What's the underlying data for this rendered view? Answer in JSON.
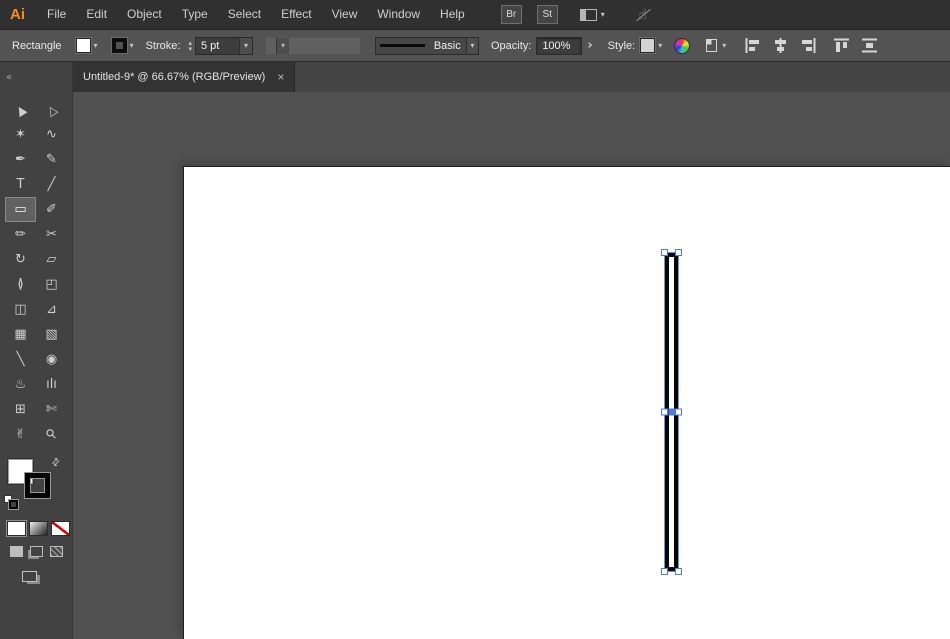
{
  "colors": {
    "accent_selection_blue": "#6f94e4",
    "handle_border_blue": "#4f7ad6",
    "menubar_bg": "#303030",
    "controlbar_bg": "#535353",
    "toolbar_bg": "#424242",
    "pasteboard_bg": "#515151",
    "artboard_bg": "#ffffff",
    "logo_orange": "#ff8a1e",
    "object_stroke": "#060606",
    "object_fill": "#ffffff"
  },
  "menubar": {
    "logo": "Ai",
    "menus": [
      {
        "label": "File",
        "name": "menu-file"
      },
      {
        "label": "Edit",
        "name": "menu-edit"
      },
      {
        "label": "Object",
        "name": "menu-object"
      },
      {
        "label": "Type",
        "name": "menu-type"
      },
      {
        "label": "Select",
        "name": "menu-select"
      },
      {
        "label": "Effect",
        "name": "menu-effect"
      },
      {
        "label": "View",
        "name": "menu-view"
      },
      {
        "label": "Window",
        "name": "menu-window"
      },
      {
        "label": "Help",
        "name": "menu-help"
      }
    ],
    "br": "Br",
    "st": "St"
  },
  "controlbar": {
    "tool_label": "Rectangle",
    "stroke_label": "Stroke:",
    "stroke_value": "5 pt",
    "brush_label": "Basic",
    "opacity_label": "Opacity:",
    "opacity_value": "100%",
    "style_label": "Style:"
  },
  "tabbar": {
    "title": "Untitled-9* @ 66.67% (RGB/Preview)",
    "close": "×"
  },
  "icons": {
    "caret": "▾",
    "stepper_up": "▴",
    "stepper_down": "▾",
    "collapse": "«",
    "swap": "⇄",
    "expand": "›",
    "touch": "☝"
  },
  "toolbar": {
    "tools": [
      {
        "name": "selection-tool",
        "glyph": "▲",
        "glyphCls": "rot-arrow"
      },
      {
        "name": "direct-selection-tool",
        "glyph": "△",
        "glyphCls": "rot-arrow"
      },
      {
        "name": "magic-wand-tool",
        "glyph": "✶"
      },
      {
        "name": "lasso-tool",
        "glyph": "∿"
      },
      {
        "name": "pen-tool",
        "glyph": "✒"
      },
      {
        "name": "curvature-tool",
        "glyph": "✎"
      },
      {
        "name": "type-tool",
        "glyph": "T"
      },
      {
        "name": "line-segment-tool",
        "glyph": "╱"
      },
      {
        "name": "rectangle-tool",
        "glyph": "▭",
        "cellCls": "selected"
      },
      {
        "name": "paintbrush-tool",
        "glyph": "✐"
      },
      {
        "name": "shaper-tool",
        "glyph": "✏"
      },
      {
        "name": "scissors-tool",
        "glyph": "✂"
      },
      {
        "name": "rotate-tool",
        "glyph": "↻"
      },
      {
        "name": "scale-tool",
        "glyph": "▱"
      },
      {
        "name": "width-tool",
        "glyph": "≬"
      },
      {
        "name": "free-transform-tool",
        "glyph": "◰"
      },
      {
        "name": "shape-builder-tool",
        "glyph": "◫"
      },
      {
        "name": "perspective-grid-tool",
        "glyph": "⊿"
      },
      {
        "name": "mesh-tool",
        "glyph": "▦"
      },
      {
        "name": "gradient-tool",
        "glyph": "▧"
      },
      {
        "name": "eyedropper-tool",
        "glyph": "╲"
      },
      {
        "name": "blend-tool",
        "glyph": "◉"
      },
      {
        "name": "symbol-sprayer-tool",
        "glyph": "♨"
      },
      {
        "name": "column-graph-tool",
        "glyph": "ılı"
      },
      {
        "name": "artboard-tool",
        "glyph": "⊞"
      },
      {
        "name": "slice-tool",
        "glyph": "✄"
      },
      {
        "name": "hand-tool",
        "glyph": "✌"
      },
      {
        "name": "zoom-tool",
        "glyph": "⚲",
        "glyphCls": "rot45"
      }
    ]
  }
}
